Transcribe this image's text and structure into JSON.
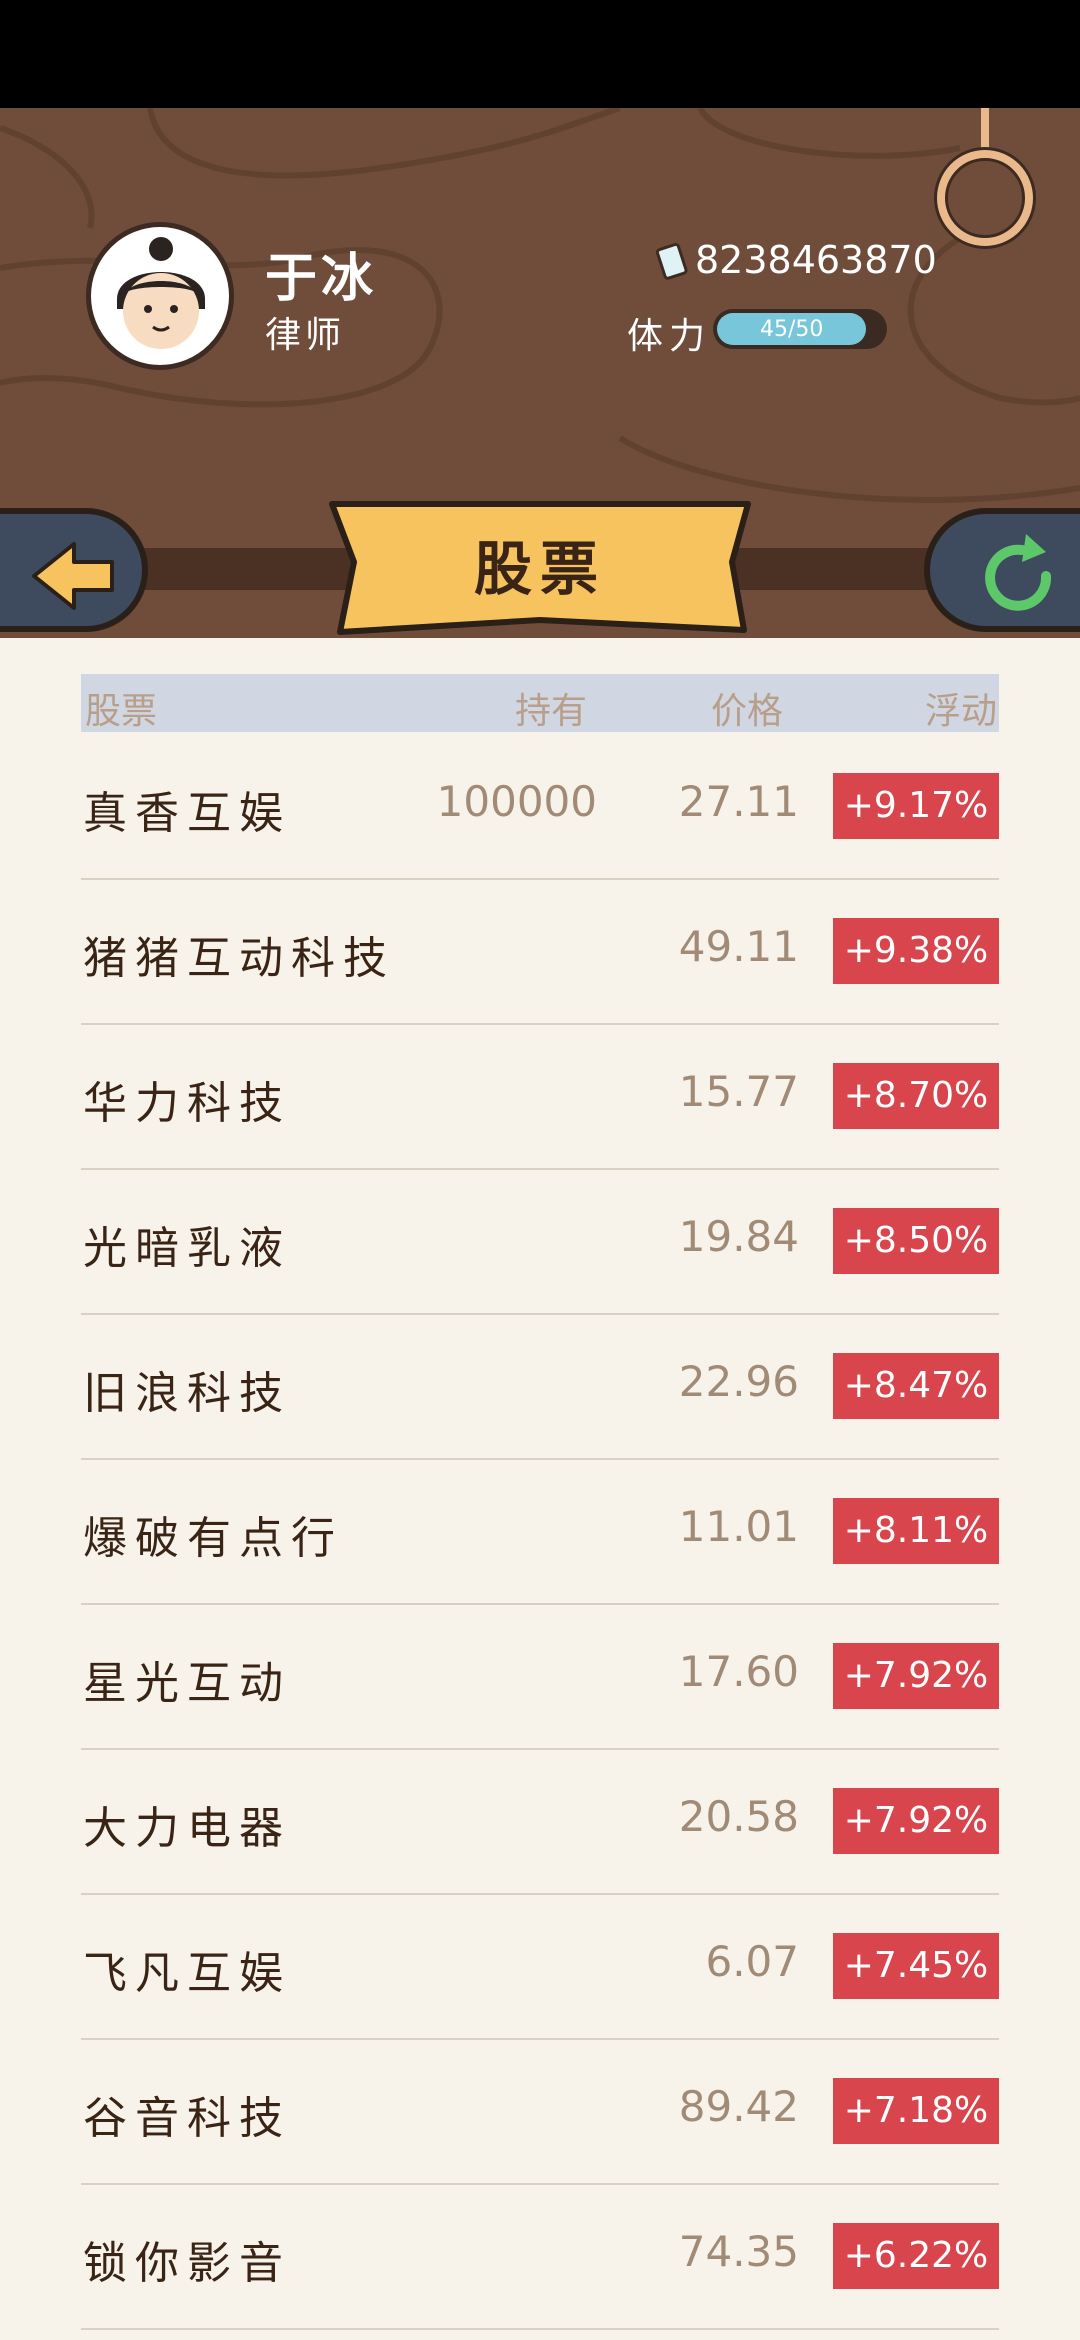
{
  "player": {
    "name": "于冰",
    "title": "律师",
    "money": "8238463870",
    "stamina_label": "体力",
    "stamina_text": "45/50",
    "stamina_fraction": 0.9
  },
  "page_title": "股票",
  "nav": {
    "back_icon": "back-arrow-icon",
    "refresh_icon": "refresh-icon"
  },
  "table": {
    "headers": {
      "stock": "股票",
      "holding": "持有",
      "price": "价格",
      "change": "浮动"
    },
    "rows": [
      {
        "name": "真香互娱",
        "holding": "100000",
        "price": "27.11",
        "change": "+9.17%"
      },
      {
        "name": "猪猪互动科技",
        "holding": "",
        "price": "49.11",
        "change": "+9.38%"
      },
      {
        "name": "华力科技",
        "holding": "",
        "price": "15.77",
        "change": "+8.70%"
      },
      {
        "name": "光暗乳液",
        "holding": "",
        "price": "19.84",
        "change": "+8.50%"
      },
      {
        "name": "旧浪科技",
        "holding": "",
        "price": "22.96",
        "change": "+8.47%"
      },
      {
        "name": "爆破有点行",
        "holding": "",
        "price": "11.01",
        "change": "+8.11%"
      },
      {
        "name": "星光互动",
        "holding": "",
        "price": "17.60",
        "change": "+7.92%"
      },
      {
        "name": "大力电器",
        "holding": "",
        "price": "20.58",
        "change": "+7.92%"
      },
      {
        "name": "飞凡互娱",
        "holding": "",
        "price": "6.07",
        "change": "+7.45%"
      },
      {
        "name": "谷音科技",
        "holding": "",
        "price": "89.42",
        "change": "+7.18%"
      },
      {
        "name": "锁你影音",
        "holding": "",
        "price": "74.35",
        "change": "+6.22%"
      }
    ]
  },
  "colors": {
    "header_wood": "#6f4d3a",
    "background": "#f7f3ea",
    "change_badge": "#d9454c",
    "banner": "#f7c35e",
    "button": "#3e4a5e"
  }
}
